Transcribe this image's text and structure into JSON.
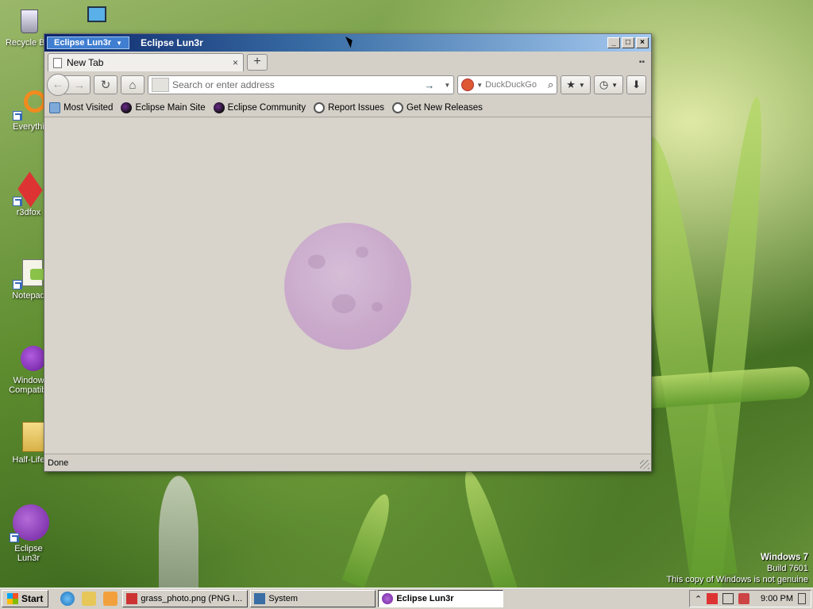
{
  "desktop": {
    "icons": [
      {
        "label": "Recycle Bin",
        "icon": "recycle-bin-icon"
      },
      {
        "label": "Everythi",
        "icon": "everything-icon"
      },
      {
        "label": "r3dfox",
        "icon": "r3dfox-icon"
      },
      {
        "label": "Notepad",
        "icon": "notepad-icon"
      },
      {
        "label": "Window Compatibi",
        "icon": "compat-icon"
      },
      {
        "label": "Half-Life",
        "icon": "half-life-icon"
      },
      {
        "label": "Eclipse Lun3r",
        "icon": "eclipse-icon"
      }
    ],
    "watermark": {
      "title": "Windows 7",
      "build": "Build 7601",
      "genuine": "This copy of Windows is not genuine"
    }
  },
  "window": {
    "app_button": "Eclipse Lun3r",
    "title": "Eclipse Lun3r",
    "controls": {
      "minimize": "_",
      "maximize": "□",
      "close": "×"
    },
    "tab": {
      "label": "New Tab",
      "close": "×"
    },
    "new_tab": "+",
    "nav": {
      "back": "←",
      "forward": "→",
      "reload": "↻",
      "home": "⌂",
      "url_placeholder": "Search or enter address",
      "go": "→",
      "search_placeholder": "DuckDuckGo",
      "search_icon": "⌕",
      "bookmarks_icon": "★",
      "history_icon": "◷",
      "download_icon": "⬇"
    },
    "bookmarks": [
      {
        "label": "Most Visited",
        "icon": "most-visited-icon"
      },
      {
        "label": "Eclipse Main Site",
        "icon": "eclipse-icon"
      },
      {
        "label": "Eclipse Community",
        "icon": "eclipse-icon"
      },
      {
        "label": "Report Issues",
        "icon": "github-icon"
      },
      {
        "label": "Get New Releases",
        "icon": "github-icon"
      }
    ],
    "status": "Done"
  },
  "taskbar": {
    "start": "Start",
    "tasks": [
      {
        "label": "grass_photo.png (PNG I...",
        "icon": "image-icon",
        "active": false
      },
      {
        "label": "System",
        "icon": "system-icon",
        "active": false
      },
      {
        "label": "Eclipse Lun3r",
        "icon": "eclipse-icon",
        "active": true
      }
    ],
    "clock": "9:00 PM"
  },
  "colors": {
    "titlebar_start": "#0a246a",
    "titlebar_end": "#a6caf0",
    "window_bg": "#d4d0c8",
    "moon": "#c9a6cc"
  }
}
